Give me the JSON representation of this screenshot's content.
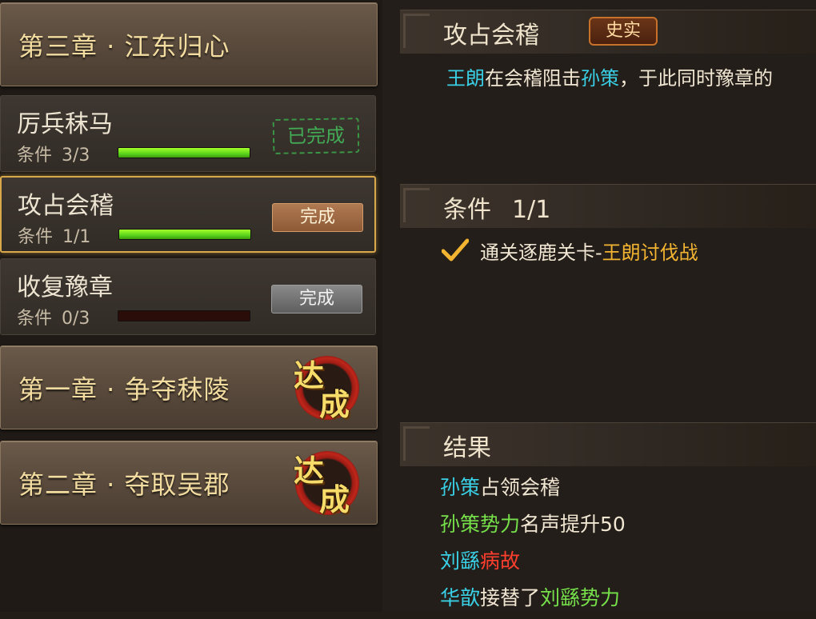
{
  "chapters": [
    {
      "title": "第三章 · 江东归心"
    },
    {
      "title": "第一章 · 争夺秣陵",
      "seal": [
        "达",
        "成"
      ]
    },
    {
      "title": "第二章 · 夺取吴郡",
      "seal": [
        "达",
        "成"
      ]
    }
  ],
  "tasks": [
    {
      "name": "厉兵秣马",
      "cond_label": "条件",
      "count": "3/3",
      "progress": 1.0,
      "status": "已完成"
    },
    {
      "name": "攻占会稽",
      "cond_label": "条件",
      "count": "1/1",
      "progress": 1.0,
      "button": "完成"
    },
    {
      "name": "收复豫章",
      "cond_label": "条件",
      "count": "0/3",
      "progress": 0.0,
      "button": "完成"
    }
  ],
  "detail": {
    "title": "攻占会稽",
    "badge": "史实",
    "desc": {
      "p1": "王朗",
      "p2": "在会稽阻击",
      "p3": "孙策",
      "p4": "，于此同时豫章的"
    },
    "conditions": {
      "label": "条件",
      "count": "1/1",
      "item_prefix": "通关逐鹿关卡-",
      "item_highlight": "王朗讨伐战"
    },
    "results": {
      "label": "结果",
      "r1": {
        "a": "孙策",
        "b": "占领会稽"
      },
      "r2": {
        "a": "孙策势力",
        "b": "名声提升50"
      },
      "r3": {
        "a": "刘繇",
        "b": "病故"
      },
      "r4": {
        "a": "华歆",
        "b": "接替了",
        "c": "刘繇势力"
      }
    }
  },
  "colors": {
    "name": "#39d0e6",
    "faction": "#76e04a",
    "death": "#ff3e2e",
    "stage": "#f3b431"
  }
}
